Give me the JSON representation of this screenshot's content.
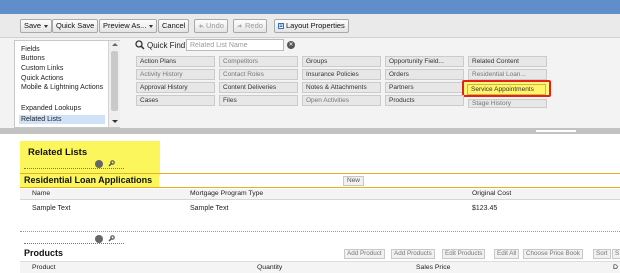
{
  "toolbar": {
    "save": "Save",
    "quick_save": "Quick Save",
    "preview_as": "Preview As...",
    "cancel": "Cancel",
    "undo": "Undo",
    "redo": "Redo",
    "layout_properties": "Layout Properties"
  },
  "palette_categories": [
    "Fields",
    "Buttons",
    "Custom Links",
    "Quick Actions",
    "Mobile & Lightning Actions",
    "Expanded Lookups",
    "Related Lists"
  ],
  "selected_category": "Related Lists",
  "quick_find": {
    "label": "Quick Find",
    "placeholder": "Related List Name"
  },
  "palette_items": [
    [
      "Action Plans",
      "Competitors",
      "Groups",
      "Opportunity Field...",
      "Related Content"
    ],
    [
      "Activity History",
      "Contact Roles",
      "Insurance Policies",
      "Orders",
      "Residential Loan..."
    ],
    [
      "Approval History",
      "Content Deliveries",
      "Notes & Attachments",
      "Partners",
      "Service Appointments"
    ],
    [
      "Cases",
      "Files",
      "Open Activities",
      "Products",
      "Stage History"
    ]
  ],
  "highlighted_item": "Service Appointments",
  "related_lists_title": "Related Lists",
  "residential": {
    "title": "Residential Loan Applications",
    "new_button": "New",
    "columns": [
      "Name",
      "Mortgage Program Type",
      "Original Cost"
    ],
    "row": [
      "Sample Text",
      "Sample Text",
      "$123.45"
    ]
  },
  "products": {
    "title": "Products",
    "buttons": [
      "Add Product",
      "Add Products",
      "Edit Products",
      "Edit All",
      "Choose Price Book",
      "Sort",
      "S"
    ],
    "columns": [
      "Product",
      "Quantity",
      "Sales Price",
      "D"
    ]
  },
  "colors": {
    "highlight_yellow": "#fbf65b",
    "highlight_red": "#e2231a",
    "section_rule": "#e8b01e",
    "top_strip": "#5f8ecb"
  }
}
